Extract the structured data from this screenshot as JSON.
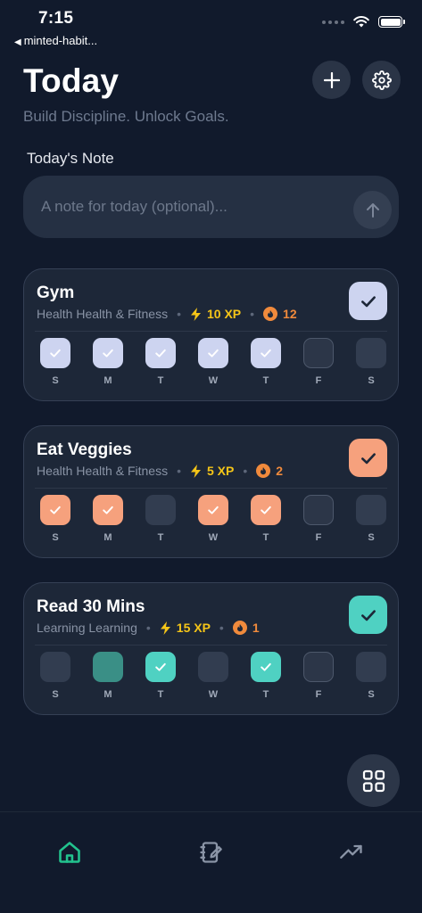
{
  "status_bar": {
    "time": "7:15",
    "back_app": "minted-habit..."
  },
  "header": {
    "title": "Today",
    "subtitle": "Build Discipline. Unlock Goals."
  },
  "note": {
    "label": "Today's Note",
    "placeholder": "A note for today (optional)...",
    "value": ""
  },
  "day_letters": [
    "S",
    "M",
    "T",
    "W",
    "T",
    "F",
    "S"
  ],
  "habits": [
    {
      "name": "Gym",
      "category": "Health Health & Fitness",
      "xp": "10 XP",
      "streak": "12",
      "color": "#cdd4f0",
      "completed_today": true,
      "days": [
        "done",
        "done",
        "done",
        "done",
        "done",
        "today",
        "empty"
      ]
    },
    {
      "name": "Eat Veggies",
      "category": "Health Health & Fitness",
      "xp": "5 XP",
      "streak": "2",
      "color": "#f6a17d",
      "completed_today": true,
      "days": [
        "done",
        "done",
        "empty",
        "done",
        "done",
        "today",
        "empty"
      ]
    },
    {
      "name": "Read 30 Mins",
      "category": "Learning Learning",
      "xp": "15 XP",
      "streak": "1",
      "color": "#4fd1c2",
      "completed_today": true,
      "days": [
        "empty",
        "partial",
        "done",
        "empty",
        "done",
        "today",
        "empty"
      ]
    }
  ],
  "icons": {
    "add": "plus-icon",
    "settings": "gear-icon",
    "send": "arrow-up-icon",
    "xp": "lightning-icon",
    "streak": "fire-badge-icon",
    "fab": "grid-icon",
    "nav_home": "home-icon",
    "nav_journal": "journal-edit-icon",
    "nav_stats": "trending-up-icon"
  },
  "colors": {
    "background": "#111a2c",
    "card": "#1d2738",
    "xp": "#f5c518",
    "streak": "#f08a3c",
    "nav_active": "#22c38e",
    "nav_inactive": "#8a94a6"
  }
}
